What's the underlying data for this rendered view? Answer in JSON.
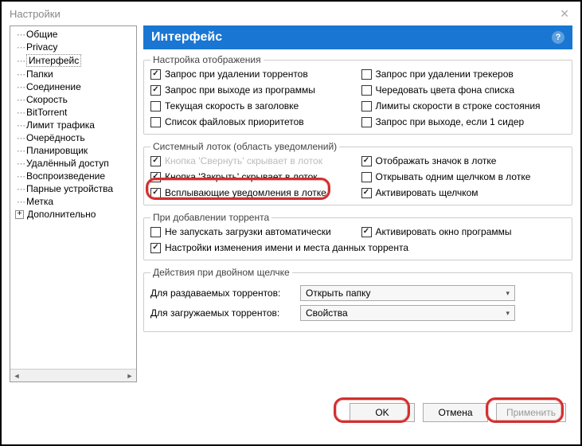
{
  "window": {
    "title": "Настройки"
  },
  "sidebar": {
    "items": [
      "Общие",
      "Privacy",
      "Интерфейс",
      "Папки",
      "Соединение",
      "Скорость",
      "BitTorrent",
      "Лимит трафика",
      "Очерёдность",
      "Планировщик",
      "Удалённый доступ",
      "Воспроизведение",
      "Парные устройства",
      "Метка",
      "Дополнительно"
    ],
    "selected_index": 2
  },
  "header": {
    "title": "Интерфейс"
  },
  "groups": {
    "display": {
      "legend": "Настройка отображения",
      "items": [
        {
          "label": "Запрос при удалении торрентов",
          "checked": true
        },
        {
          "label": "Запрос при удалении трекеров",
          "checked": false
        },
        {
          "label": "Запрос при выходе из программы",
          "checked": true
        },
        {
          "label": "Чередовать цвета фона списка",
          "checked": false
        },
        {
          "label": "Текущая скорость в заголовке",
          "checked": false
        },
        {
          "label": "Лимиты скорости в строке состояния",
          "checked": false
        },
        {
          "label": "Список файловых приоритетов",
          "checked": false
        },
        {
          "label": "Запрос при выходе, если 1 сидер",
          "checked": false
        }
      ]
    },
    "tray": {
      "legend": "Системный лоток (область уведомлений)",
      "items": [
        {
          "label": "Кнопка 'Свернуть' скрывает в лоток",
          "checked": true,
          "cut": true
        },
        {
          "label": "Отображать значок в лотке",
          "checked": true
        },
        {
          "label": "Кнопка 'Закрыть' скрывает в лоток",
          "checked": true
        },
        {
          "label": "Открывать одним щелчком в лотке",
          "checked": false
        },
        {
          "label": "Всплывающие уведомления в лотке",
          "checked": true
        },
        {
          "label": "Активировать щелчком",
          "checked": true
        }
      ]
    },
    "add": {
      "legend": "При добавлении торрента",
      "items": [
        {
          "label": "Не запускать загрузки автоматически",
          "checked": false
        },
        {
          "label": "Активировать окно программы",
          "checked": true
        },
        {
          "label": "Настройки изменения имени и места данных торрента",
          "checked": true,
          "full": true
        }
      ]
    },
    "dblclick": {
      "legend": "Действия при двойном щелчке",
      "rows": [
        {
          "label": "Для раздаваемых торрентов:",
          "value": "Открыть папку"
        },
        {
          "label": "Для загружаемых торрентов:",
          "value": "Свойства"
        }
      ]
    }
  },
  "buttons": {
    "ok": "OK",
    "cancel": "Отмена",
    "apply": "Применить"
  }
}
